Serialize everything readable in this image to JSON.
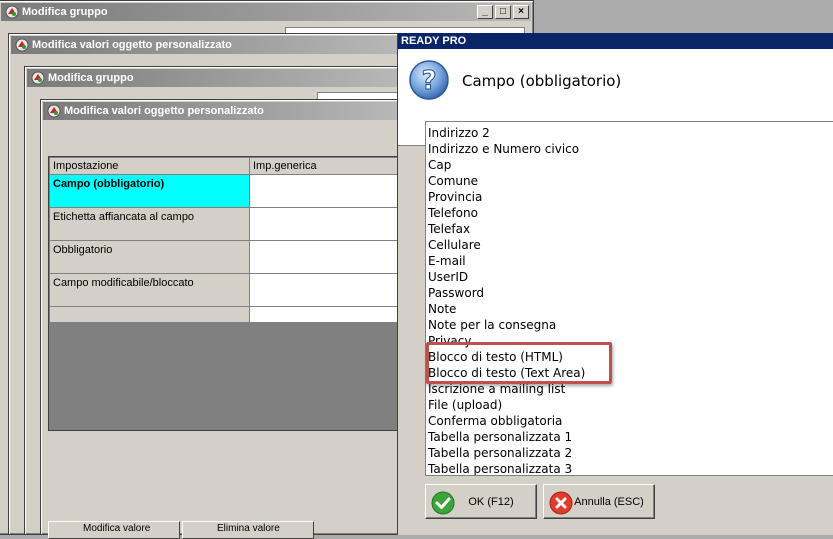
{
  "windows": {
    "back1": {
      "title": "Modifica gruppo"
    },
    "back2": {
      "title": "Modifica valori oggetto personalizzato"
    },
    "back3": {
      "title": "Modifica gruppo"
    },
    "front": {
      "title": "Modifica valori oggetto personalizzato",
      "grid": {
        "columns": [
          "Impostazione",
          "Imp.generica"
        ],
        "rows": [
          {
            "label": "Campo (obbligatorio)",
            "value": ""
          },
          {
            "label": "Etichetta affiancata al campo",
            "value": ""
          },
          {
            "label": "Obbligatorio",
            "value": ""
          },
          {
            "label": "Campo modificabile/bloccato",
            "value": ""
          }
        ]
      },
      "buttons": {
        "modify": "Modifica valore",
        "delete": "Elimina valore"
      }
    }
  },
  "dialog": {
    "title": "READY PRO",
    "heading": "Campo (obbligatorio)",
    "options": [
      "Indirizzo 2",
      "Indirizzo e Numero civico",
      "Cap",
      "Comune",
      "Provincia",
      "Telefono",
      "Telefax",
      "Cellulare",
      "E-mail",
      "UserID",
      "Password",
      "Note",
      "Note per la consegna",
      "Privacy",
      "Blocco di testo (HTML)",
      "Blocco di testo (Text Area)",
      "Iscrizione a mailing list",
      "File (upload)",
      "Conferma obbligatoria",
      "Tabella personalizzata 1",
      "Tabella personalizzata 2",
      "Tabella personalizzata 3"
    ],
    "ok_label": "OK (F12)",
    "cancel_label": "Annulla (ESC)"
  },
  "colors": {
    "selected_cell": "#00ffff",
    "dialog_title_bg": "#0a246a",
    "highlight_border": "#c0504d"
  }
}
